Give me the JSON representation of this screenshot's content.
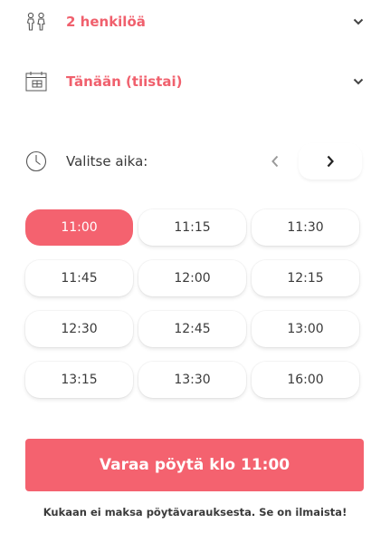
{
  "party": {
    "value": "2 henkilöä",
    "icon": "people-icon"
  },
  "date": {
    "value": "Tänään (tiistai)",
    "icon": "calendar-icon"
  },
  "time": {
    "label": "Valitse aika:",
    "icon": "clock-icon"
  },
  "slots": {
    "selected": "11:00",
    "items": [
      "11:00",
      "11:15",
      "11:30",
      "11:45",
      "12:00",
      "12:15",
      "12:30",
      "12:45",
      "13:00",
      "13:15",
      "13:30",
      "16:00"
    ]
  },
  "book_button": {
    "label": "Varaa pöytä klo 11:00"
  },
  "note": "Kukaan ei maksa pöytävarauksesta. Se on ilmaista!",
  "colors": {
    "accent": "#f4626f",
    "text": "#3a3a3a",
    "muted": "#9a9a9a"
  }
}
